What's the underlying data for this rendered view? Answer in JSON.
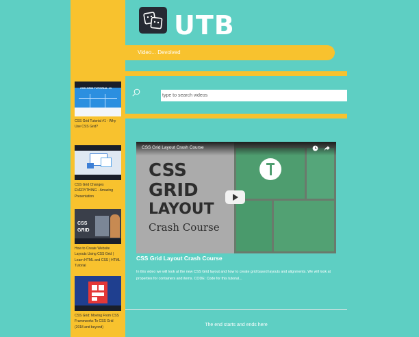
{
  "header": {
    "site_title": "UTB",
    "tagline": "Video... Devolved"
  },
  "search": {
    "placeholder": "type to search videos"
  },
  "sidebar": {
    "items": [
      {
        "title": "CSS Grid Tutorial #1 - Why Use CSS Grid?",
        "thumb_caption": "CSS GRID TUTORIAL #1"
      },
      {
        "title": "CSS Grid Changes EVERYTHING - Amazing Presentation",
        "thumb_caption": ""
      },
      {
        "title": "How to Create Website Layouts Using CSS Grid | Learn HTML and CSS | HTML Tutorial",
        "thumb_caption": "CSS GRID"
      },
      {
        "title": "CSS Grid: Moving From CSS Frameworks To CSS Grid (2018 and beyond)",
        "thumb_caption": ""
      }
    ]
  },
  "video": {
    "player_title": "CSS Grid Layout Crash Course",
    "thumb_lines": [
      "CSS",
      "GRID",
      "LAYOUT",
      "Crash Course"
    ],
    "heading": "CSS Grid Layout Crash Course",
    "description": "In this video we will look at the new CSS Grid layout and how to create grid based layouts and alignments. We will look at properties for containers and items. CODE: Code for this tutorial..."
  },
  "footer": {
    "text": "The end starts and ends here"
  },
  "colors": {
    "teal": "#5ecfc3",
    "yellow": "#f8c22e",
    "dark": "#262a33"
  }
}
